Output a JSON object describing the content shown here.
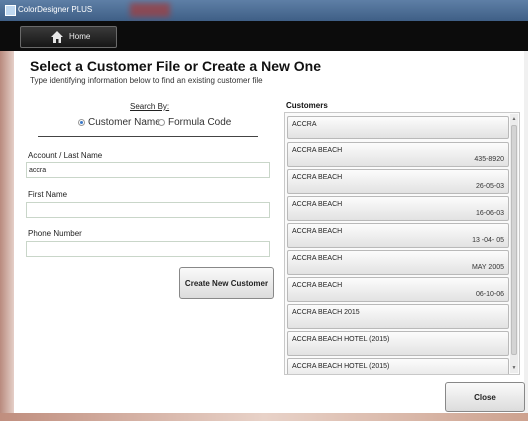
{
  "window": {
    "title": "ColorDesigner PLUS"
  },
  "nav": {
    "home_label": "Home"
  },
  "heading": "Select a Customer File or Create a New One",
  "subheading": "Type identifying information below to find an existing customer file",
  "search": {
    "label": "Search By:",
    "options": [
      {
        "label": "Customer Name",
        "checked": true
      },
      {
        "label": "Formula Code",
        "checked": false
      }
    ]
  },
  "fields": {
    "account_last_name": {
      "label": "Account / Last Name",
      "value": "accra"
    },
    "first_name": {
      "label": "First Name",
      "value": ""
    },
    "phone_number": {
      "label": "Phone Number",
      "value": ""
    }
  },
  "create_button": "Create New Customer",
  "customers": {
    "label": "Customers",
    "items": [
      {
        "name": "ACCRA",
        "detail": ""
      },
      {
        "name": "ACCRA BEACH",
        "detail": "435-8920"
      },
      {
        "name": "ACCRA BEACH",
        "detail": "26-05-03"
      },
      {
        "name": "ACCRA BEACH",
        "detail": "16-06-03"
      },
      {
        "name": "ACCRA BEACH",
        "detail": "13 -04- 05"
      },
      {
        "name": "ACCRA BEACH",
        "detail": "MAY 2005"
      },
      {
        "name": "ACCRA BEACH",
        "detail": "06-10-06"
      },
      {
        "name": "ACCRA BEACH 2015",
        "detail": ""
      },
      {
        "name": "ACCRA BEACH HOTEL (2015)",
        "detail": ""
      },
      {
        "name": "ACCRA BEACH HOTEL (2015)",
        "detail": ""
      }
    ]
  },
  "close_button": "Close"
}
